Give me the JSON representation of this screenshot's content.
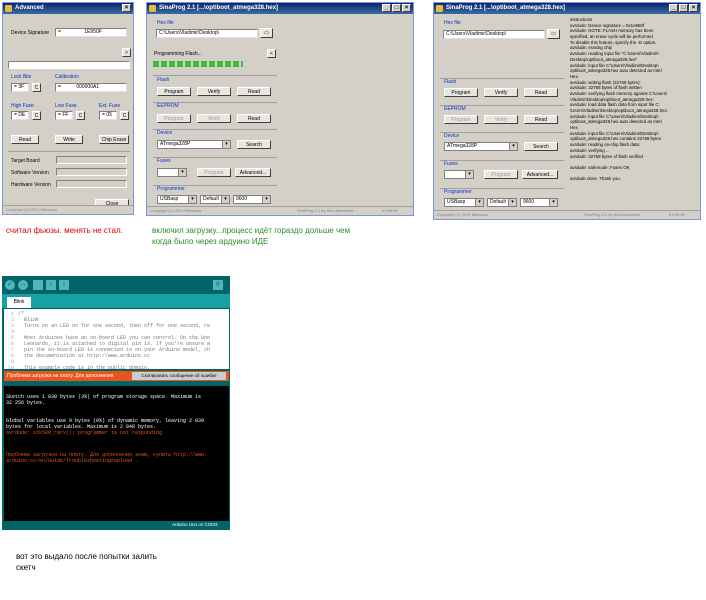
{
  "advanced": {
    "title": "Advanced",
    "sig_label": "Device Signature",
    "sig_value": "1E950F",
    "sig_prefix": "=",
    "btn_more": ">",
    "lock_label": "Lock Bits",
    "lock_value": "3F",
    "cal_label": "Calibration",
    "cal_value": "000000A1",
    "high_label": "High Fuse",
    "high_value": "DE",
    "low_label": "Low Fuse",
    "low_value": "FF",
    "ext_label": "Ext. Fuse",
    "ext_value": "05",
    "c": "C",
    "read": "Read",
    "write": "Write",
    "chip_erase": "Chip Erase",
    "target_board": "Target Board",
    "software_version": "Software Version",
    "hardware_version": "Hardware Version",
    "close": "Close",
    "status": "Copyright (C) 2011 Mirocasa"
  },
  "sina_mid": {
    "title": "SinaProg 2.1 [...\\optiboot_atmega328.hex]",
    "hex_label": "Hex file",
    "hex_value": "C:\\Users\\Vladimir\\Desktop\\",
    "prog_status": "Programming Flash...",
    "flash_label": "Flash",
    "eeprom_label": "EEPROM",
    "device_label": "Device",
    "device_value": "ATmega328P",
    "fuses_label": "Fuses",
    "programmer_label": "Programmer",
    "prog_value": "USBasp",
    "port_value": "Default",
    "baud_value": "9600",
    "program": "Program",
    "verify": "Verify",
    "read": "Read",
    "search": "Search",
    "advanced": "Advanced...",
    "status_left": "Copyright (C) 2011 Mirocasa",
    "status_right": "SinaProg 2.1 by Sina Abdolhimi",
    "status_time": "01:58:55"
  },
  "sina_right": {
    "title": "SinaProg 2.1 [...\\optiboot_atmega328.hex]",
    "hex_label": "Hex file",
    "hex_value": "C:\\Users\\Vladimir\\Desktop\\",
    "flash_label": "Flash",
    "eeprom_label": "EEPROM",
    "device_label": "Device",
    "device_value": "ATmega328P",
    "fuses_label": "Fuses",
    "programmer_label": "Programmer",
    "prog_value": "USBasp",
    "port_value": "Default",
    "baud_value": "9600",
    "program": "Program",
    "verify": "Verify",
    "read": "Read",
    "search": "Search",
    "advanced": "Advanced...",
    "status_left": "Copyright (C) 2011 Mirocasa",
    "status_right": "SinaProg 2.1 by Sina Abdolhimi",
    "status_time": "01:59:35",
    "log": [
      "instructions",
      "avrdude: Device signature = 0x1e950f",
      "avrdude: NOTE: FLASH memory has been",
      "specified, an erase cycle will be performed",
      "        To disable this feature, specify the -D option.",
      "avrdude: erasing chip",
      "avrdude: reading input file \"C:\\Users\\Vladimir\\",
      "Desktop\\optiboot_atmega328.hex\"",
      "avrdude: input file C:\\Users\\Vladimir\\Desktop\\",
      "optiboot_atmega328.hex auto detected as Intel",
      "Hex",
      "avrdude: writing flash (32768 bytes):",
      "avrdude: 32768 bytes of flash written",
      "avrdude: verifying flash memory against C:\\Users\\",
      "Vladimir\\Desktop\\optiboot_atmega328.hex:",
      "avrdude: load data flash data from input file C:",
      "\\Users\\Vladimir\\Desktop\\optiboot_atmega328.hex:",
      "avrdude: input file C:\\Users\\Vladimir\\Desktop\\",
      "optiboot_atmega328.hex auto detected as Intel",
      "Hex",
      "avrdude: input file C:\\Users\\Vladimir\\Desktop\\",
      "optiboot_atmega328.hex contains 32768 bytes",
      "avrdude: reading on-chip flash data:",
      "avrdude: verifying ...",
      "avrdude: 32768 bytes of flash verified",
      "",
      "avrdude: safemode: Fuses OK",
      "",
      "avrdude done.  Thank you."
    ]
  },
  "captions": {
    "fuses": "считал фьюзы. менять не стал.",
    "upload_line1": "включил загрузку...процесс идёт гораздо дольше чем",
    "upload_line2": "когда было через ардуино ИДЕ",
    "sketch_line1": "вот это выдало после попытки залить",
    "sketch_line2": "скетч"
  },
  "arduino": {
    "tab": "Blink",
    "code_lines": [
      "/*",
      "  Blink",
      "  Turns on an LED on for one second, then off for one second, re",
      "",
      "  Most Arduinos have an on-board LED you can control. On the Uno",
      "  Leonardo, it is attached to digital pin 13. If you're unsure w",
      "  pin the on-board LED is connected to on your Arduino model, ch",
      "  the documentation at http://www.arduino.cc",
      "",
      "  This example code is in the public domain."
    ],
    "error_bar": "Проблема загрузки на плату. Для дополнения",
    "copy_button": "Скопировать сообщение об ошибке",
    "console": [
      "Sketch uses 1 030 bytes (3%) of program storage space. Maximum is",
      "32 256 bytes.",
      "",
      "Global variables use 9 bytes (0%) of dynamic memory, leaving 2 039",
      "bytes for local variables. Maximum is 2 048 bytes.",
      "avrdude: stk500_recv(): programmer is not responding",
      "",
      "Проблема загрузки на плату. Для дополнения знаю, купить http://www.",
      "arduino.cc/en/Guide/Troubleshooting#upload ."
    ],
    "board_status": "Arduino Uno on COM3"
  },
  "colors": {
    "caption_red": "#dd0000",
    "caption_green": "#2a8a2a",
    "arduino_teal": "#006468",
    "error_orange": "#e8541a"
  }
}
